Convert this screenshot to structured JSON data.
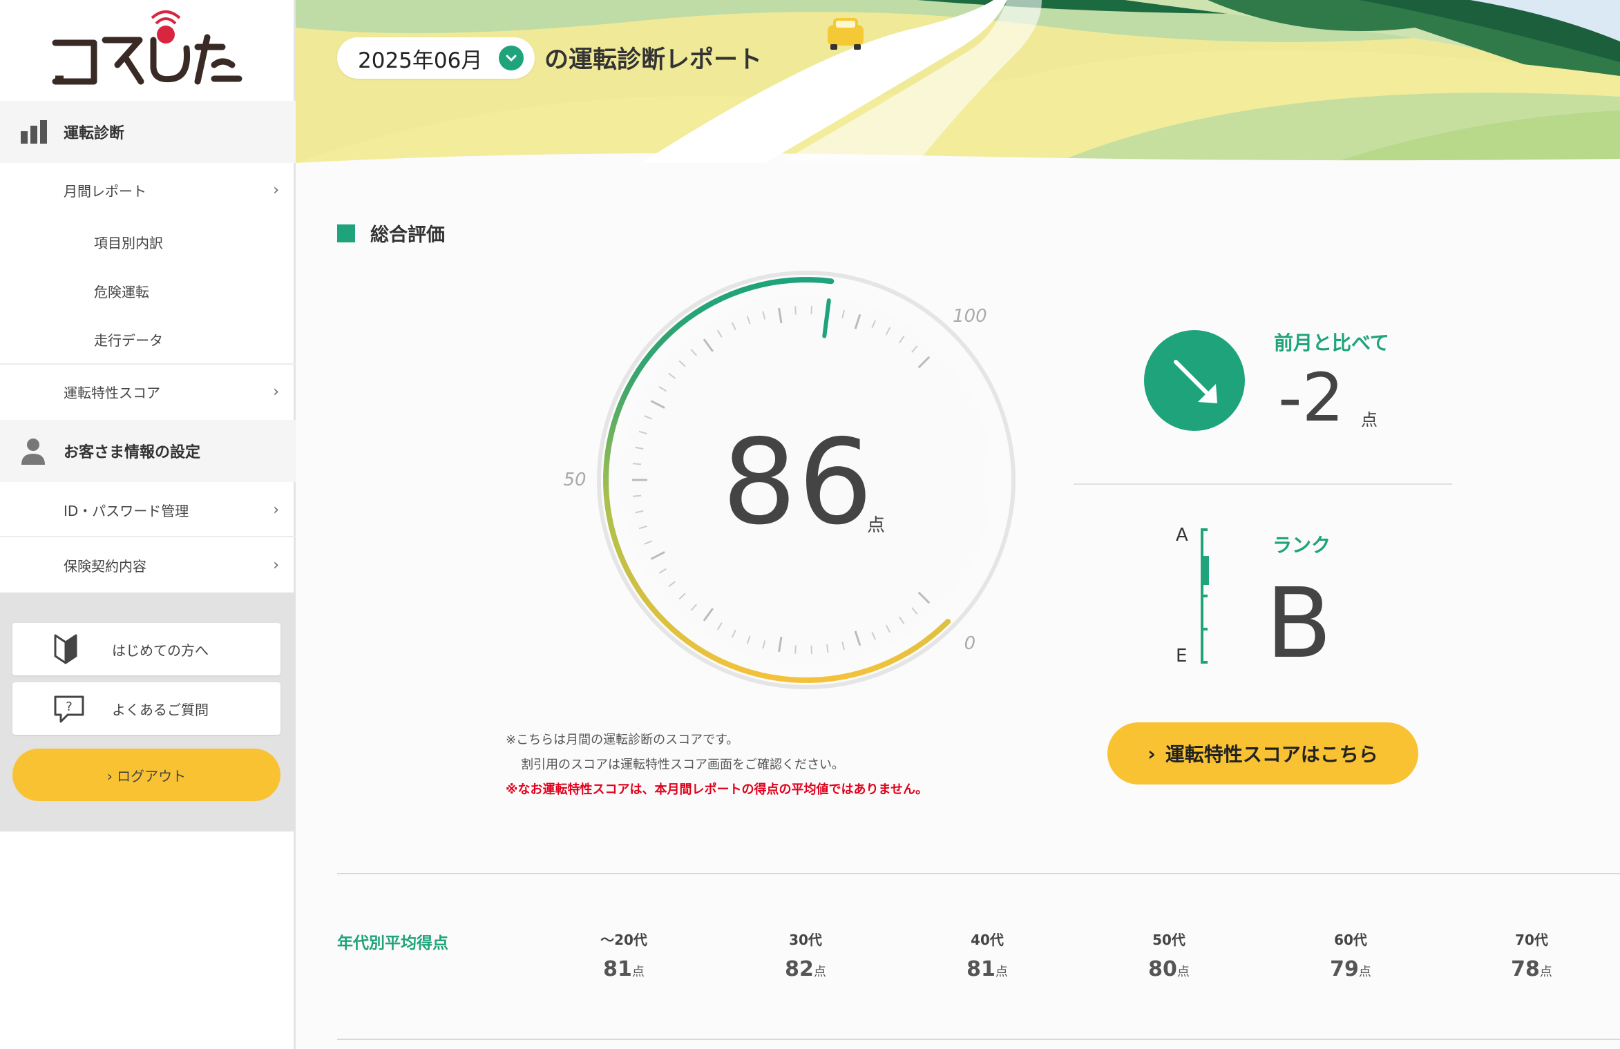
{
  "sidebar": {
    "logo_text": "コネひた",
    "section_driving": "運転診断",
    "monthly_report": "月間レポート",
    "sub_items": [
      "項目別内訳",
      "危険運転",
      "走行データ"
    ],
    "driving_score": "運転特性スコア",
    "section_customer": "お客さま情報の設定",
    "id_password": "ID・パスワード管理",
    "insurance": "保険契約内容",
    "first_time": "はじめての方へ",
    "faq": "よくあるご質問",
    "logout": "› ログアウト"
  },
  "header": {
    "month": "2025年06月",
    "title": "の運転診断レポート"
  },
  "main": {
    "section_title": "総合評価",
    "gauge": {
      "score": "86",
      "unit": "点",
      "label_100": "100",
      "label_50": "50",
      "label_0": "0",
      "value": 86,
      "max": 100
    },
    "comparison": {
      "label": "前月と比べて",
      "value": "-2",
      "unit": "点"
    },
    "rank": {
      "label": "ランク",
      "value": "B",
      "top": "A",
      "bottom": "E"
    },
    "notes": [
      "※こちらは月間の運転診断のスコアです。",
      "割引用のスコアは運転特性スコア画面をご確認ください。",
      "※なお運転特性スコアは、本月間レポートの得点の平均値ではありません。"
    ],
    "score_button": "運転特性スコアはこちら",
    "age_avg": {
      "title": "年代別平均得点",
      "unit": "点",
      "columns": [
        {
          "age": "～20代",
          "score": "81"
        },
        {
          "age": "30代",
          "score": "82"
        },
        {
          "age": "40代",
          "score": "81"
        },
        {
          "age": "50代",
          "score": "80"
        },
        {
          "age": "60代",
          "score": "79"
        },
        {
          "age": "70代",
          "score": "78"
        }
      ]
    }
  },
  "colors": {
    "accent": "#1ea37a",
    "yellow": "#f8c232",
    "red": "#e1001b"
  }
}
